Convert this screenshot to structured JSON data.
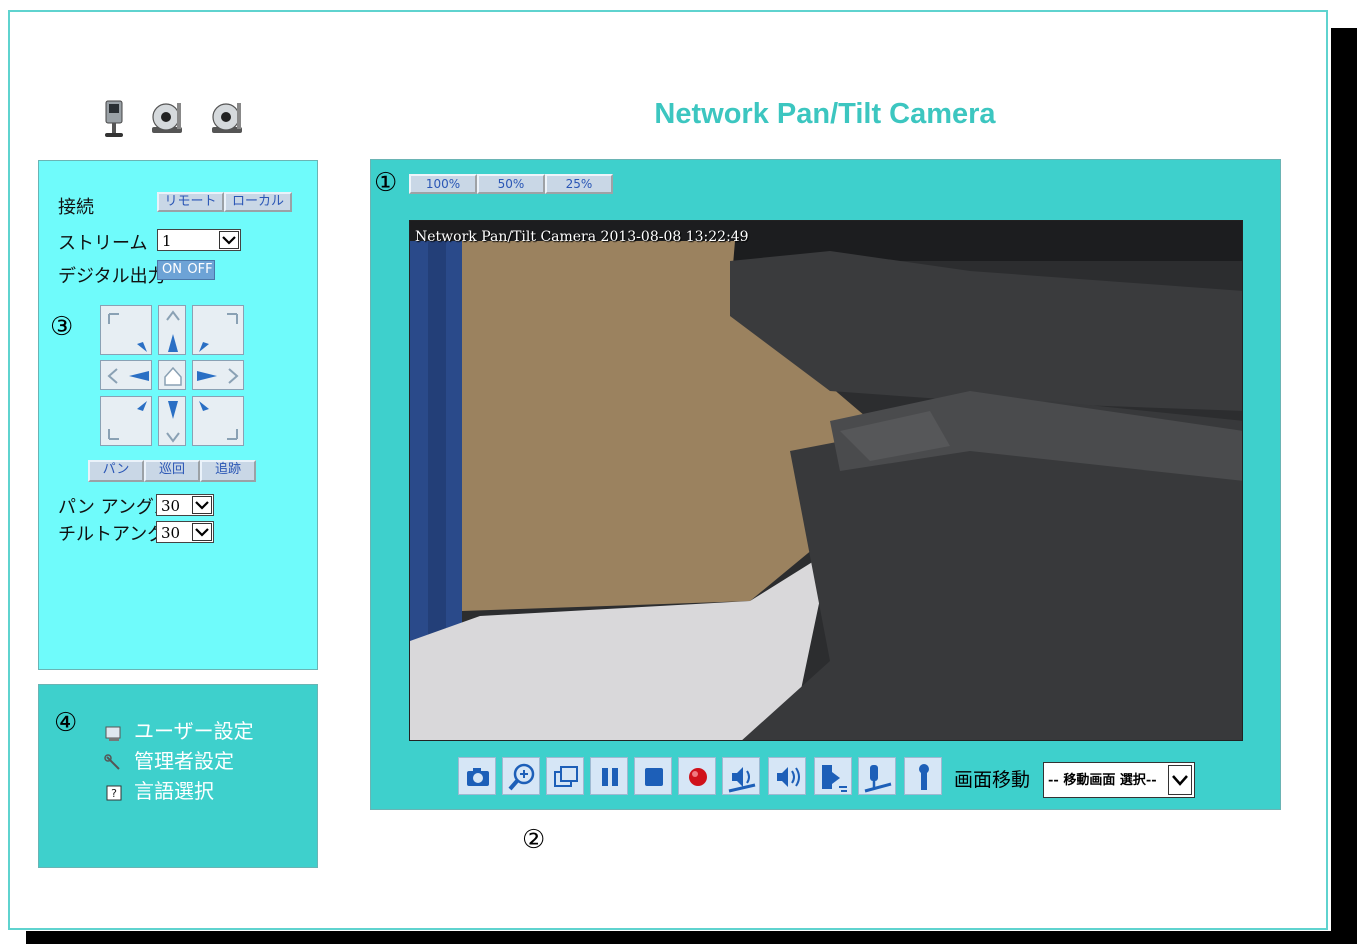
{
  "header": {
    "title": "Network Pan/Tilt Camera",
    "camera_icons": [
      "box-camera-icon",
      "ptz-camera-icon",
      "ptz-camera-icon"
    ]
  },
  "control_panel": {
    "marker": "③",
    "connection_label": "接続",
    "connection_buttons": [
      "リモート",
      "ローカル"
    ],
    "stream_label": "ストリーム",
    "stream_value": "1",
    "digital_output_label": "デジタル出力",
    "digital_output_on": "ON",
    "digital_output_off": "OFF",
    "ptz_buttons": [
      "パン",
      "巡回",
      "追跡"
    ],
    "pan_angle_label": "パン アングル",
    "pan_angle_value": "30",
    "tilt_angle_label": "チルトアングル",
    "tilt_angle_value": "30"
  },
  "menu_panel": {
    "marker": "④",
    "items": [
      {
        "label": "ユーザー設定",
        "icon": "user-settings-icon"
      },
      {
        "label": "管理者設定",
        "icon": "admin-settings-icon"
      },
      {
        "label": "言語選択",
        "icon": "language-help-icon"
      }
    ]
  },
  "viewer": {
    "marker_top": "①",
    "marker_bottom": "②",
    "size_buttons": [
      "100%",
      "50%",
      "25%"
    ],
    "osd_text": "Network Pan/Tilt Camera 2013-08-08 13:22:49",
    "toolbar_icons": [
      "snapshot-icon",
      "zoom-in-icon",
      "fullscreen-icon",
      "pause-icon",
      "stop-icon",
      "record-icon",
      "speaker-icon",
      "volume-icon",
      "talk-icon",
      "microphone-icon",
      "microphone-off-icon"
    ],
    "screen_move_label": "画面移動",
    "screen_move_value": "-- 移動画面 選択--"
  },
  "colors": {
    "accent": "#3ed0cc",
    "control_panel_bg": "#6ffbfb",
    "title": "#3cc6c0",
    "button_text": "#2a56b5"
  }
}
